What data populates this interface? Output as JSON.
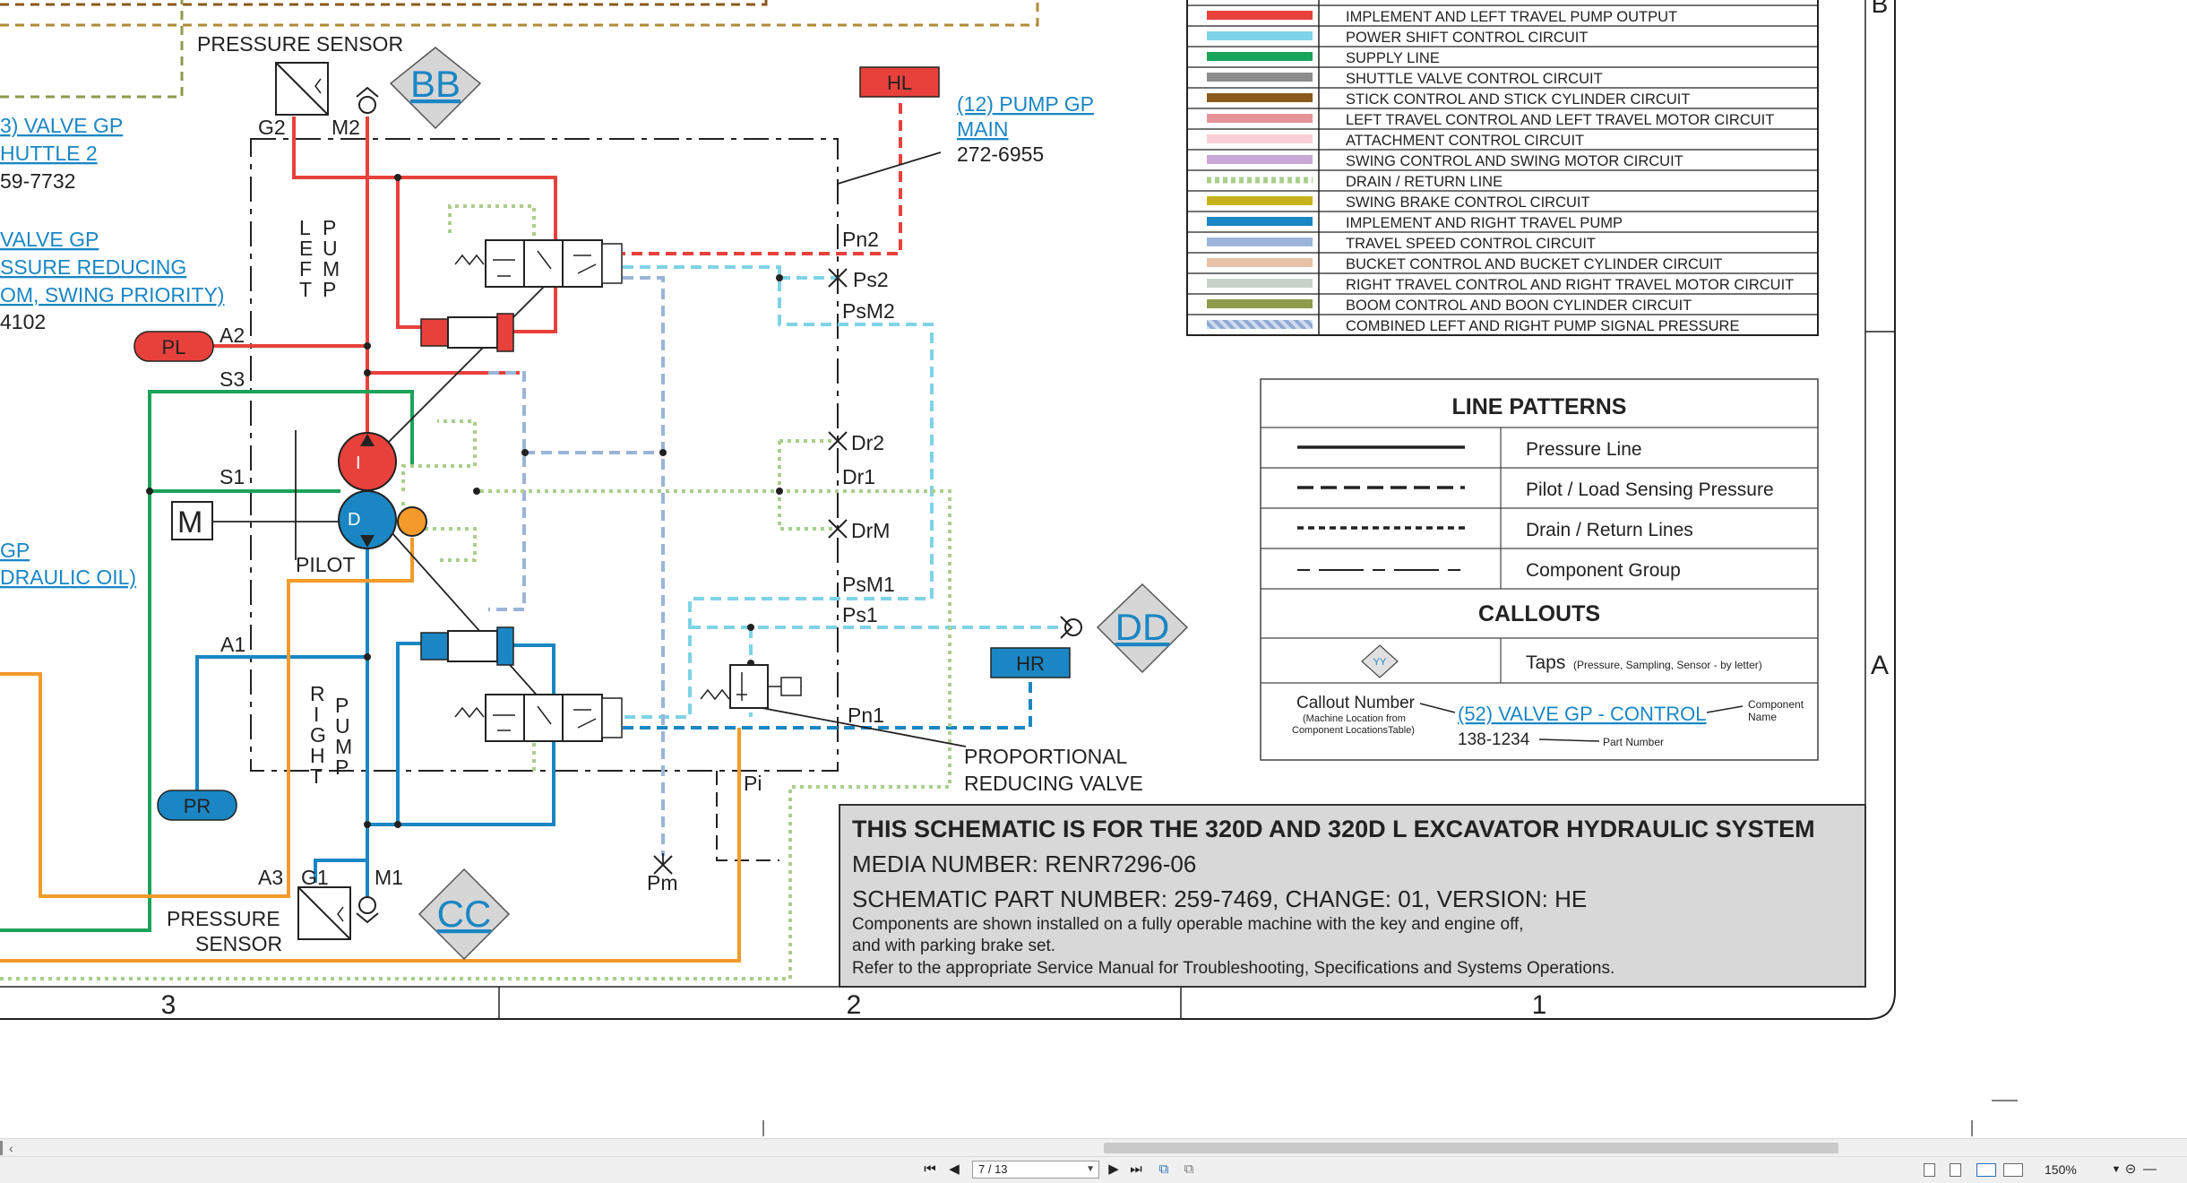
{
  "schematic": {
    "labels": {
      "pressure_sensor_top": "PRESSURE SENSOR",
      "bb": "BB",
      "cc": "CC",
      "dd": "DD",
      "g2": "G2",
      "m2": "M2",
      "g1": "G1",
      "m1": "M1",
      "a1": "A1",
      "a2": "A2",
      "a3": "A3",
      "s1": "S1",
      "s3": "S3",
      "left_pump": [
        "L",
        "E",
        "F",
        "T"
      ],
      "left_pump2": [
        "P",
        "U",
        "M",
        "P"
      ],
      "right_pump": [
        "R",
        "I",
        "G",
        "H",
        "T"
      ],
      "right_pump2": [
        "P",
        "U",
        "M",
        "P"
      ],
      "pilot": "PILOT",
      "pump_i": "I",
      "pump_d": "D",
      "pn2": "Pn2",
      "ps2": "Ps2",
      "psm2": "PsM2",
      "dr2": "Dr2",
      "dr1": "Dr1",
      "drm": "DrM",
      "psm1": "PsM1",
      "ps1": "Ps1",
      "pn1": "Pn1",
      "pi": "Pi",
      "pm": "Pm",
      "hl": "HL",
      "hr": "HR",
      "pl": "PL",
      "pr": "PR",
      "pump_gp_1": "(12) PUMP GP",
      "pump_gp_2": "MAIN",
      "pump_gp_3": "272-6955",
      "valve_gp_a1": "3) VALVE GP",
      "valve_gp_a2": "HUTTLE 2",
      "valve_gp_a3": "59-7732",
      "valve_gp_b1": " VALVE GP",
      "valve_gp_b2": "SSURE REDUCING",
      "valve_gp_b3": "OM, SWING PRIORITY)",
      "valve_gp_b4": "4102",
      "gp_c1": "GP",
      "gp_c2": "DRAULIC OIL)",
      "prop_valve_1": "PROPORTIONAL",
      "prop_valve_2": "REDUCING VALVE",
      "pressure_sensor_bot_1": "PRESSURE",
      "pressure_sensor_bot_2": "SENSOR",
      "m_box": "M"
    },
    "zone_numbers": [
      "3",
      "2",
      "1"
    ],
    "zone_letters": [
      "B",
      "A"
    ]
  },
  "legend": {
    "items": [
      {
        "label": "IMPLEMENT AND LEFT TRAVEL PUMP OUTPUT",
        "color": "#e8413c"
      },
      {
        "label": "POWER SHIFT CONTROL CIRCUIT",
        "color": "#7fd3e6"
      },
      {
        "label": "SUPPLY LINE",
        "color": "#1aa35a"
      },
      {
        "label": "SHUTTLE VALVE CONTROL CIRCUIT",
        "color": "#8c8c8c"
      },
      {
        "label": "STICK CONTROL AND STICK CYLINDER CIRCUIT",
        "color": "#8a5a1c"
      },
      {
        "label": "LEFT TRAVEL CONTROL AND LEFT TRAVEL MOTOR CIRCUIT",
        "color": "#e5959a"
      },
      {
        "label": "ATTACHMENT CONTROL CIRCUIT",
        "color": "#fbd0d6"
      },
      {
        "label": "SWING CONTROL AND SWING MOTOR CIRCUIT",
        "color": "#c8a8d6"
      },
      {
        "label": "DRAIN / RETURN LINE",
        "color": "#a9cf8a",
        "pattern": "dotted"
      },
      {
        "label": "SWING BRAKE CONTROL CIRCUIT",
        "color": "#c8b21c"
      },
      {
        "label": "IMPLEMENT AND RIGHT TRAVEL  PUMP",
        "color": "#1a86c4"
      },
      {
        "label": "TRAVEL SPEED CONTROL CIRCUIT",
        "color": "#9bb4d9"
      },
      {
        "label": "BUCKET CONTROL AND BUCKET CYLINDER CIRCUIT",
        "color": "#e6c2a6"
      },
      {
        "label": "RIGHT TRAVEL CONTROL AND RIGHT TRAVEL MOTOR CIRCUIT",
        "color": "#c6d2c8"
      },
      {
        "label": "BOOM CONTROL AND BOON CYLINDER CIRCUIT",
        "color": "#8e9a4c"
      },
      {
        "label": "COMBINED LEFT AND RIGHT PUMP SIGNAL PRESSURE",
        "color": "#9bb4d9",
        "pattern": "hatched"
      }
    ]
  },
  "line_patterns": {
    "title": "LINE PATTERNS",
    "rows": [
      {
        "label": "Pressure Line",
        "style": "solid"
      },
      {
        "label": "Pilot / Load Sensing Pressure",
        "style": "dashed"
      },
      {
        "label": "Drain / Return Lines",
        "style": "dotted"
      },
      {
        "label": "Component Group",
        "style": "dashdot"
      }
    ],
    "callouts_title": "CALLOUTS",
    "taps_label": "Taps",
    "taps_sub": "(Pressure, Sampling, Sensor - by letter)",
    "taps_glyph": "YY",
    "callout_number": "Callout Number",
    "callout_number_sub1": "(Machine Location from",
    "callout_number_sub2": "Component LocationsTable)",
    "component_link": "(52) VALVE GP - CONTROL",
    "component_name_1": "Component",
    "component_name_2": "Name",
    "part_number_value": "138-1234",
    "part_number_label": "Part Number"
  },
  "title_block": {
    "title": "THIS SCHEMATIC IS FOR THE  320D AND 320D L EXCAVATOR HYDRAULIC SYSTEM",
    "media": "MEDIA NUMBER: RENR7296-06",
    "part": "SCHEMATIC PART NUMBER: 259-7469, CHANGE: 01, VERSION: HE",
    "note1": "Components are shown installed on a fully operable machine with the key and engine off,",
    "note2": "and with parking brake set.",
    "note3": "Refer to the appropriate Service Manual for Troubleshooting, Specifications and Systems Operations."
  },
  "toolbar": {
    "page_value": "7 / 13",
    "zoom_value": "150%",
    "first_icon": "first-page-icon",
    "prev_icon": "previous-page-icon",
    "next_icon": "next-page-icon",
    "last_icon": "last-page-icon"
  },
  "colors": {
    "red": "#e8413c",
    "blue": "#1a86c4",
    "green": "#1aa35a",
    "orange": "#f39a2b",
    "cyan": "#7fd3e6",
    "drain": "#a9cf8a",
    "steel": "#9bb4d9",
    "link": "#1a86c4",
    "olive": "#8e9a4c"
  }
}
